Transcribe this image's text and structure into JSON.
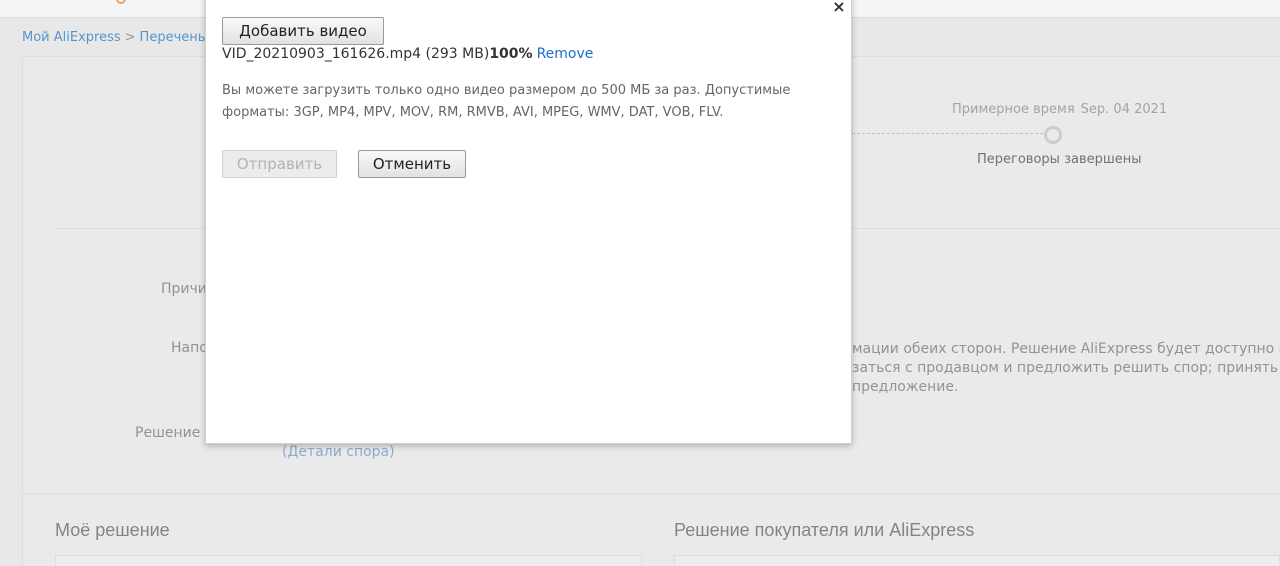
{
  "breadcrumb": {
    "home": "Мой AliExpress",
    "separator": ">",
    "current": "Перечень сп"
  },
  "progress": {
    "est_label": "Примерное время",
    "est_date": "Sep. 04 2021",
    "final_status": "Переговоры завершены"
  },
  "fields": {
    "reason_label": "Причи",
    "remind_label": "Напо",
    "decision_label": "Решение А",
    "details_link": "(Детали спора)"
  },
  "remind_text": {
    "line1": "мации обеих сторон. Решение AliExpress будет доступно на",
    "line2": "заться с продавцом и предложить решить спор; принять",
    "line3": "предложение."
  },
  "sections": {
    "my_decision": "Моё решение",
    "buyer_decision": "Решение покупателя или AliExpress"
  },
  "modal": {
    "close_glyph": "×",
    "add_video_label": "Добавить видео",
    "file_name": "VID_20210903_161626.mp4 (293 MB)",
    "upload_progress": "100%",
    "remove_label": "Remove",
    "hint_line1": "Вы можете загрузить только одно видео размером до 500 МБ за раз. Допустимые",
    "hint_line2": "форматы: 3GP, MP4, MPV, MOV, RM, RMVB, AVI, MPEG, WMV, DAT, VOB, FLV.",
    "send_label": "Отправить",
    "cancel_label": "Отменить"
  },
  "colors": {
    "link": "#1a6fc4",
    "muted_link": "#5b9bd5",
    "disabled_text": "#b3b3b3"
  }
}
